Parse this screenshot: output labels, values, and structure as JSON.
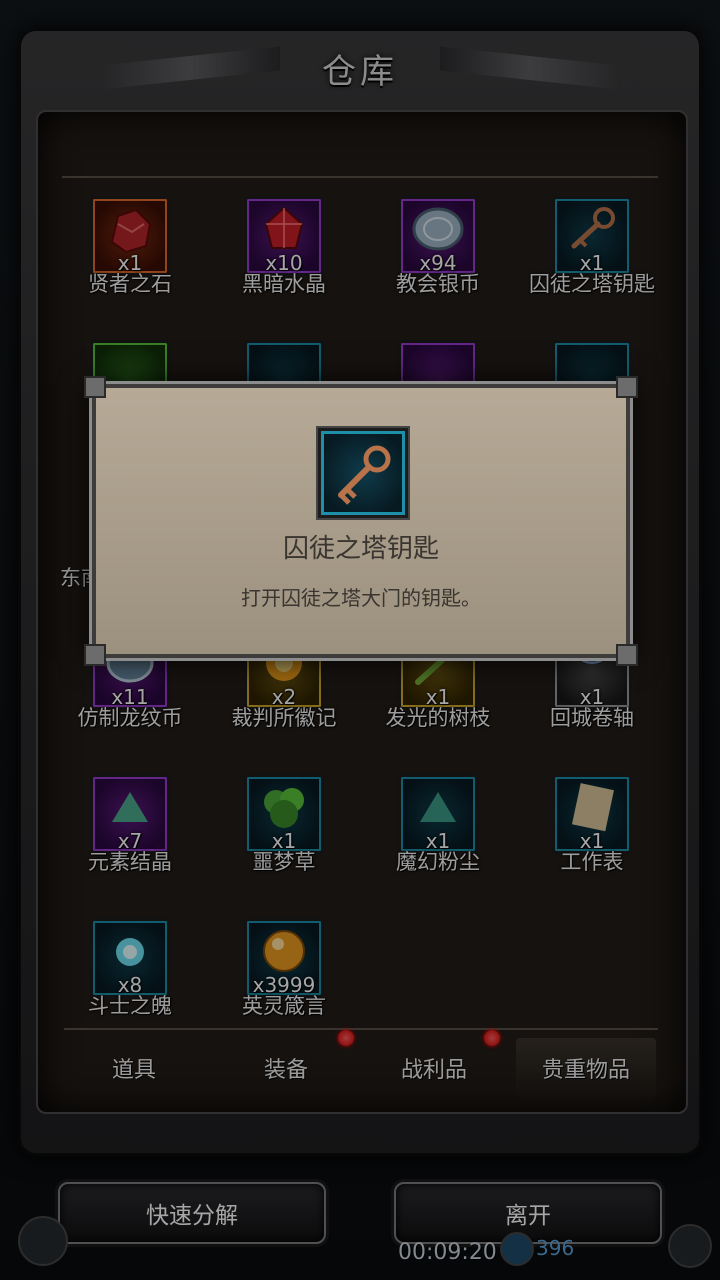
{
  "window": {
    "title": "仓库"
  },
  "items": [
    {
      "name": "贤者之石",
      "count": "x1",
      "rarity": "orange",
      "icon": "red-stone-icon"
    },
    {
      "name": "黑暗水晶",
      "count": "x10",
      "rarity": "purple",
      "icon": "dark-crystal-icon"
    },
    {
      "name": "教会银币",
      "count": "x94",
      "rarity": "purple",
      "icon": "silver-coin-icon"
    },
    {
      "name": "囚徒之塔钥匙",
      "count": "x1",
      "rarity": "teal",
      "icon": "key-icon"
    },
    {
      "name": "仿制龙纹币",
      "count": "x11",
      "rarity": "purple",
      "icon": "dragon-coin-icon"
    },
    {
      "name": "裁判所徽记",
      "count": "x2",
      "rarity": "gold",
      "icon": "emblem-icon"
    },
    {
      "name": "发光的树枝",
      "count": "x1",
      "rarity": "gold",
      "icon": "glowing-branch-icon"
    },
    {
      "name": "回城卷轴",
      "count": "x1",
      "rarity": "grey",
      "icon": "scroll-icon"
    },
    {
      "name": "元素结晶",
      "count": "x7",
      "rarity": "purple",
      "icon": "element-crystal-icon"
    },
    {
      "name": "噩梦草",
      "count": "x1",
      "rarity": "teal",
      "icon": "herb-icon"
    },
    {
      "name": "魔幻粉尘",
      "count": "x1",
      "rarity": "teal",
      "icon": "magic-dust-icon"
    },
    {
      "name": "工作表",
      "count": "x1",
      "rarity": "teal",
      "icon": "paper-icon"
    },
    {
      "name": "斗士之魄",
      "count": "x8",
      "rarity": "teal",
      "icon": "soul-flame-icon"
    },
    {
      "name": "英灵箴言",
      "count": "x3999",
      "rarity": "teal",
      "icon": "golden-orb-icon"
    }
  ],
  "hidden_row": {
    "partial_left_text": "东南",
    "tiles": [
      "green",
      "teal",
      "purple",
      "teal"
    ]
  },
  "tabs": [
    {
      "label": "道具",
      "badge": false,
      "active": false
    },
    {
      "label": "装备",
      "badge": true,
      "active": false
    },
    {
      "label": "战利品",
      "badge": true,
      "active": false
    },
    {
      "label": "贵重物品",
      "badge": false,
      "active": true
    }
  ],
  "buttons": {
    "decompose": "快速分解",
    "leave": "离开"
  },
  "hud": {
    "time": "00:09:20",
    "gems": "396"
  },
  "popup": {
    "title": "囚徒之塔钥匙",
    "description": "打开囚徒之塔大门的钥匙。",
    "icon": "key-icon"
  },
  "colors": {
    "teal": "#1d8fa8",
    "purple": "#9a3cd2",
    "orange": "#e06a2a",
    "gold": "#d2aa2a",
    "badge": "#ff3030"
  }
}
